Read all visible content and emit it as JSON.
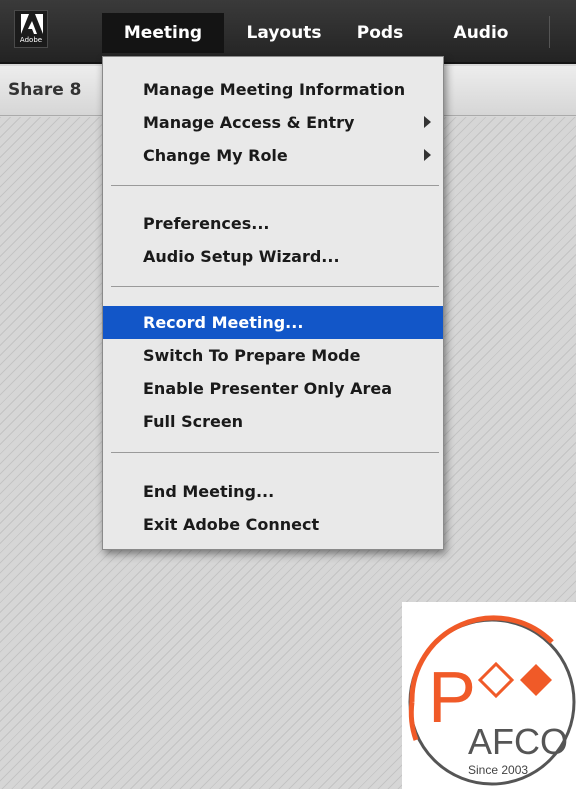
{
  "app": {
    "logo_text": "Adobe"
  },
  "menubar": {
    "tabs": [
      {
        "label": "Meeting",
        "active": true
      },
      {
        "label": "Layouts",
        "active": false
      },
      {
        "label": "Pods",
        "active": false
      },
      {
        "label": "Audio",
        "active": false
      }
    ]
  },
  "share_pod": {
    "title": "Share 8"
  },
  "meeting_menu": {
    "items": [
      {
        "label": "Manage Meeting Information",
        "submenu": false
      },
      {
        "label": "Manage Access & Entry",
        "submenu": true
      },
      {
        "label": "Change My Role",
        "submenu": true
      },
      {
        "label": "Preferences...",
        "submenu": false
      },
      {
        "label": "Audio Setup Wizard...",
        "submenu": false
      },
      {
        "label": "Record Meeting...",
        "submenu": false,
        "highlighted": true
      },
      {
        "label": "Switch To Prepare Mode",
        "submenu": false
      },
      {
        "label": "Enable Presenter Only Area",
        "submenu": false
      },
      {
        "label": "Full Screen",
        "submenu": false
      },
      {
        "label": "End Meeting...",
        "submenu": false
      },
      {
        "label": "Exit Adobe Connect",
        "submenu": false
      }
    ]
  },
  "watermark": {
    "brand": "AFCO",
    "letter": "P",
    "tagline": "Since 2003"
  },
  "colors": {
    "highlight": "#1256c8",
    "watermark_accent": "#f05a28",
    "menubar": "#2b2b2b"
  }
}
